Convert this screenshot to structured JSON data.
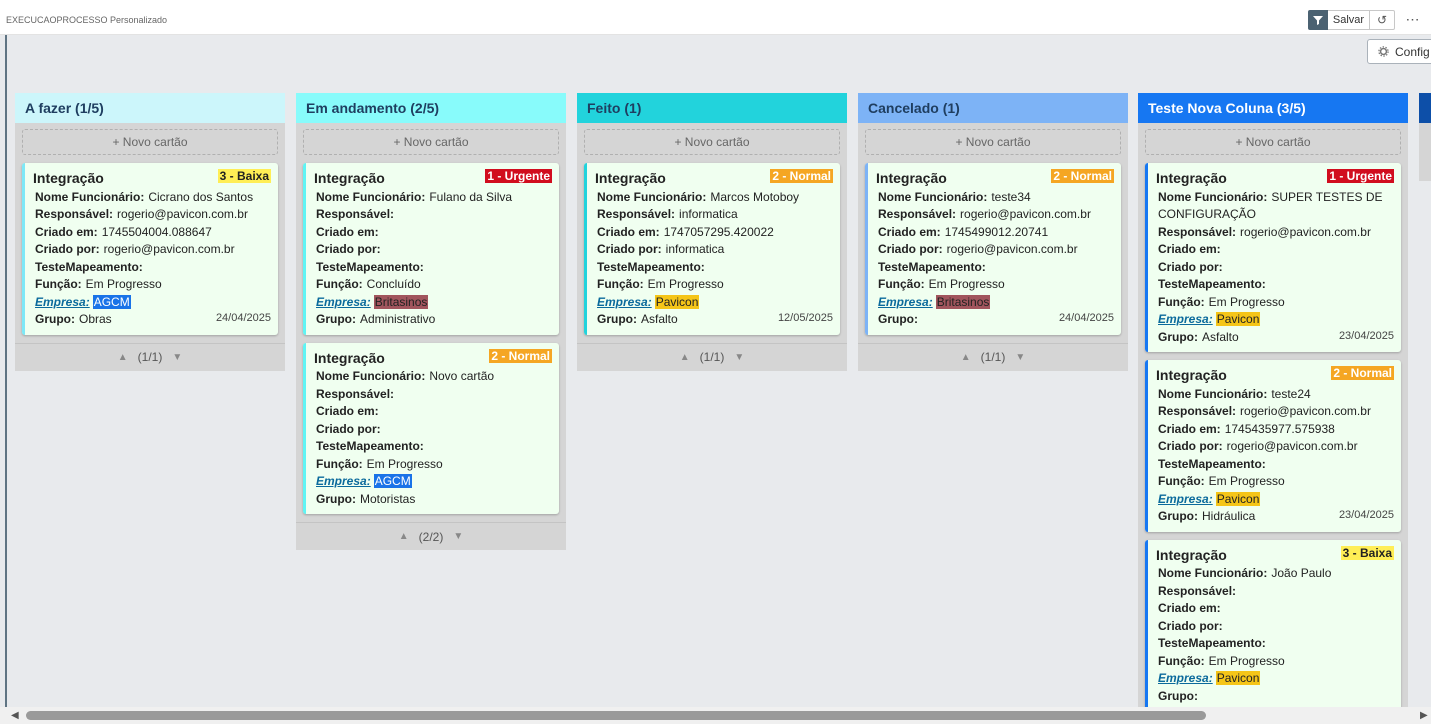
{
  "app": {
    "title": "EXECUCAOPROCESSO Personalizado"
  },
  "toolbar": {
    "save_label": "Salvar",
    "config_label": "Config",
    "more_label": "⋯"
  },
  "new_card_label": "+ Novo cartão",
  "fields": {
    "nome": "Nome Funcionário:",
    "responsavel": "Responsável:",
    "criado_em": "Criado em:",
    "criado_por": "Criado por:",
    "teste": "TesteMapeamento:",
    "funcao": "Função:",
    "empresa": "Empresa:",
    "grupo": "Grupo:"
  },
  "colors": {
    "urgent_bg": "#d10d1e",
    "normal_bg": "#f5a623",
    "baixa_bg": "#ffee55",
    "agcm_bg": "#1a73e8",
    "britasinos_bg": "#a1555d",
    "pavicon_bg": "#f5c518"
  },
  "columns": [
    {
      "title": "A fazer (1/5)",
      "header_bg": "#ccf6fb",
      "accent": "#7de8f7",
      "pager": "(1/1)",
      "cards": [
        {
          "title": "Integração",
          "priority": "3 - Baixa",
          "priority_type": "baixa",
          "nome": "Cicrano dos Santos",
          "responsavel": "rogerio@pavicon.com.br",
          "criado_em": "1745504004.088647",
          "criado_por": "rogerio@pavicon.com.br",
          "teste": "",
          "funcao": "Em Progresso",
          "empresa": "AGCM",
          "empresa_type": "agcm",
          "grupo": "Obras",
          "date": "24/04/2025"
        }
      ]
    },
    {
      "title": "Em andamento (2/5)",
      "header_bg": "#88fbfb",
      "accent": "#5ff4f4",
      "pager": "(2/2)",
      "cards": [
        {
          "title": "Integração",
          "priority": "1 - Urgente",
          "priority_type": "urgent",
          "nome": "Fulano da Silva",
          "responsavel": "",
          "criado_em": "",
          "criado_por": "",
          "teste": "",
          "funcao": "Concluído",
          "empresa": "Britasinos",
          "empresa_type": "britasinos",
          "grupo": "Administrativo",
          "date": ""
        },
        {
          "title": "Integração",
          "priority": "2 - Normal",
          "priority_type": "normal",
          "nome": "Novo cartão",
          "responsavel": "",
          "criado_em": "",
          "criado_por": "",
          "teste": "",
          "funcao": "Em Progresso",
          "empresa": "AGCM",
          "empresa_type": "agcm",
          "grupo": "Motoristas",
          "date": ""
        }
      ]
    },
    {
      "title": "Feito (1)",
      "header_bg": "#22d3dc",
      "accent": "#22d3dc",
      "pager": "(1/1)",
      "cards": [
        {
          "title": "Integração",
          "priority": "2 - Normal",
          "priority_type": "normal",
          "nome": "Marcos Motoboy",
          "responsavel": "informatica",
          "criado_em": "1747057295.420022",
          "criado_por": "informatica",
          "teste": "",
          "funcao": "Em Progresso",
          "empresa": "Pavicon",
          "empresa_type": "pavicon",
          "grupo": "Asfalto",
          "date": "12/05/2025"
        }
      ]
    },
    {
      "title": "Cancelado (1)",
      "header_bg": "#7db3f6",
      "accent": "#7db3f6",
      "pager": "(1/1)",
      "cards": [
        {
          "title": "Integração",
          "priority": "2 - Normal",
          "priority_type": "normal",
          "nome": "teste34",
          "responsavel": "rogerio@pavicon.com.br",
          "criado_em": "1745499012.20741",
          "criado_por": "rogerio@pavicon.com.br",
          "teste": "",
          "funcao": "Em Progresso",
          "empresa": "Britasinos",
          "empresa_type": "britasinos",
          "grupo": "",
          "date": "24/04/2025"
        }
      ]
    },
    {
      "title": "Teste Nova Coluna (3/5)",
      "header_bg": "#1677f2",
      "accent": "#1677f2",
      "pager": "",
      "cards": [
        {
          "title": "Integração",
          "priority": "1 - Urgente",
          "priority_type": "urgent",
          "nome": "SUPER TESTES DE CONFIGURAÇÃO",
          "responsavel": "rogerio@pavicon.com.br",
          "criado_em": "",
          "criado_por": "",
          "teste": "",
          "funcao": "Em Progresso",
          "empresa": "Pavicon",
          "empresa_type": "pavicon",
          "grupo": "Asfalto",
          "date": "23/04/2025"
        },
        {
          "title": "Integração",
          "priority": "2 - Normal",
          "priority_type": "normal",
          "nome": "teste24",
          "responsavel": "rogerio@pavicon.com.br",
          "criado_em": "1745435977.575938",
          "criado_por": "rogerio@pavicon.com.br",
          "teste": "",
          "funcao": "Em Progresso",
          "empresa": "Pavicon",
          "empresa_type": "pavicon",
          "grupo": "Hidráulica",
          "date": "23/04/2025"
        },
        {
          "title": "Integração",
          "priority": "3 - Baixa",
          "priority_type": "baixa",
          "nome": "João Paulo",
          "responsavel": "",
          "criado_em": "",
          "criado_por": "",
          "teste": "",
          "funcao": "Em Progresso",
          "empresa": "Pavicon",
          "empresa_type": "pavicon",
          "grupo": "",
          "date": ""
        }
      ]
    }
  ]
}
